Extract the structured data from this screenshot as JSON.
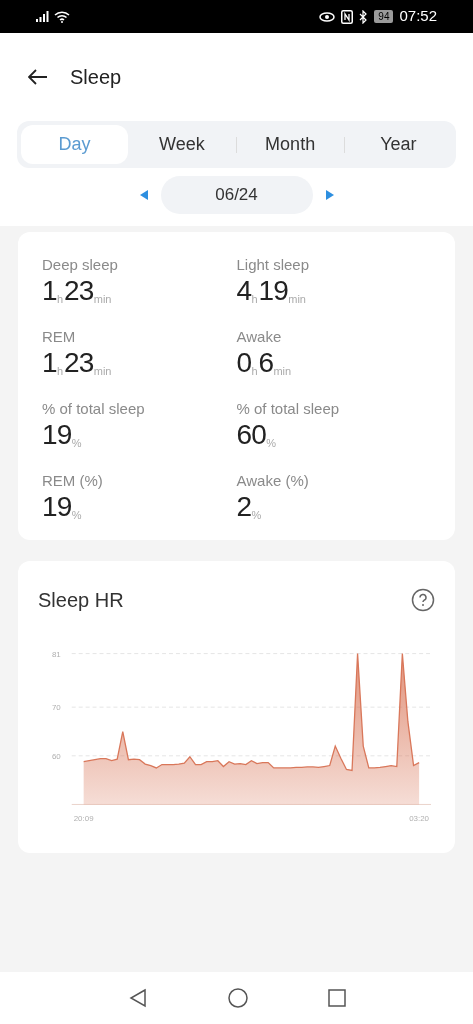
{
  "status_bar": {
    "battery": "94",
    "time": "07:52"
  },
  "header": {
    "title": "Sleep"
  },
  "tabs": [
    {
      "label": "Day",
      "selected": true
    },
    {
      "label": "Week",
      "selected": false
    },
    {
      "label": "Month",
      "selected": false
    },
    {
      "label": "Year",
      "selected": false
    }
  ],
  "date": "06/24",
  "stats": [
    {
      "label": "Deep sleep",
      "parts": [
        {
          "value": "1",
          "unit": "h"
        },
        {
          "value": "23",
          "unit": "min"
        }
      ]
    },
    {
      "label": "Light sleep",
      "parts": [
        {
          "value": "4",
          "unit": "h"
        },
        {
          "value": "19",
          "unit": "min"
        }
      ]
    },
    {
      "label": "REM",
      "parts": [
        {
          "value": "1",
          "unit": "h"
        },
        {
          "value": "23",
          "unit": "min"
        }
      ]
    },
    {
      "label": "Awake",
      "parts": [
        {
          "value": "0",
          "unit": "h"
        },
        {
          "value": "6",
          "unit": "min"
        }
      ]
    },
    {
      "label": "% of total sleep",
      "parts": [
        {
          "value": "19",
          "unit": "%"
        }
      ]
    },
    {
      "label": "% of total sleep",
      "parts": [
        {
          "value": "60",
          "unit": "%"
        }
      ]
    },
    {
      "label": "REM (%)",
      "parts": [
        {
          "value": "19",
          "unit": "%"
        }
      ]
    },
    {
      "label": "Awake (%)",
      "parts": [
        {
          "value": "2",
          "unit": "%"
        }
      ]
    }
  ],
  "hr_card": {
    "chart_data": {
      "type": "area",
      "ylim": [
        50,
        81
      ],
      "yticks": [
        60,
        70,
        81
      ],
      "categories": [
        "20:09",
        null,
        null,
        null,
        null,
        null,
        null,
        null,
        null,
        null,
        null,
        null,
        null,
        null,
        null,
        null,
        null,
        null,
        null,
        null,
        null,
        null,
        null,
        null,
        null,
        null,
        null,
        null,
        null,
        null,
        null,
        null,
        null,
        null,
        null,
        null,
        null,
        null,
        null,
        null,
        null,
        null,
        null,
        null,
        null,
        null,
        null,
        null,
        null,
        null,
        null,
        null,
        null,
        null,
        null,
        null,
        null,
        null,
        null,
        null,
        "03:20"
      ],
      "series": [
        {
          "name": "Sleep HR",
          "color": "#d9775a",
          "values": [
            58.8,
            59.0,
            59.2,
            59.4,
            59.4,
            59.0,
            59.3,
            65,
            59.2,
            59.3,
            59.2,
            58.3,
            58.0,
            57.5,
            58.2,
            58.2,
            58.2,
            58.3,
            58.5,
            59.8,
            58.2,
            58.2,
            58.8,
            58.8,
            59.0,
            57.8,
            58.8,
            58.3,
            58.4,
            58.2,
            59.0,
            58.4,
            58.6,
            58.6,
            57.5,
            57.5,
            57.5,
            57.5,
            57.6,
            57.6,
            57.7,
            57.7,
            57.6,
            57.8,
            58.0,
            62,
            59.5,
            57.2,
            57.0,
            81,
            62,
            57.5,
            57.5,
            57.6,
            57.8,
            58.0,
            57.8,
            81,
            67,
            58.0,
            58.6
          ]
        }
      ]
    }
  }
}
